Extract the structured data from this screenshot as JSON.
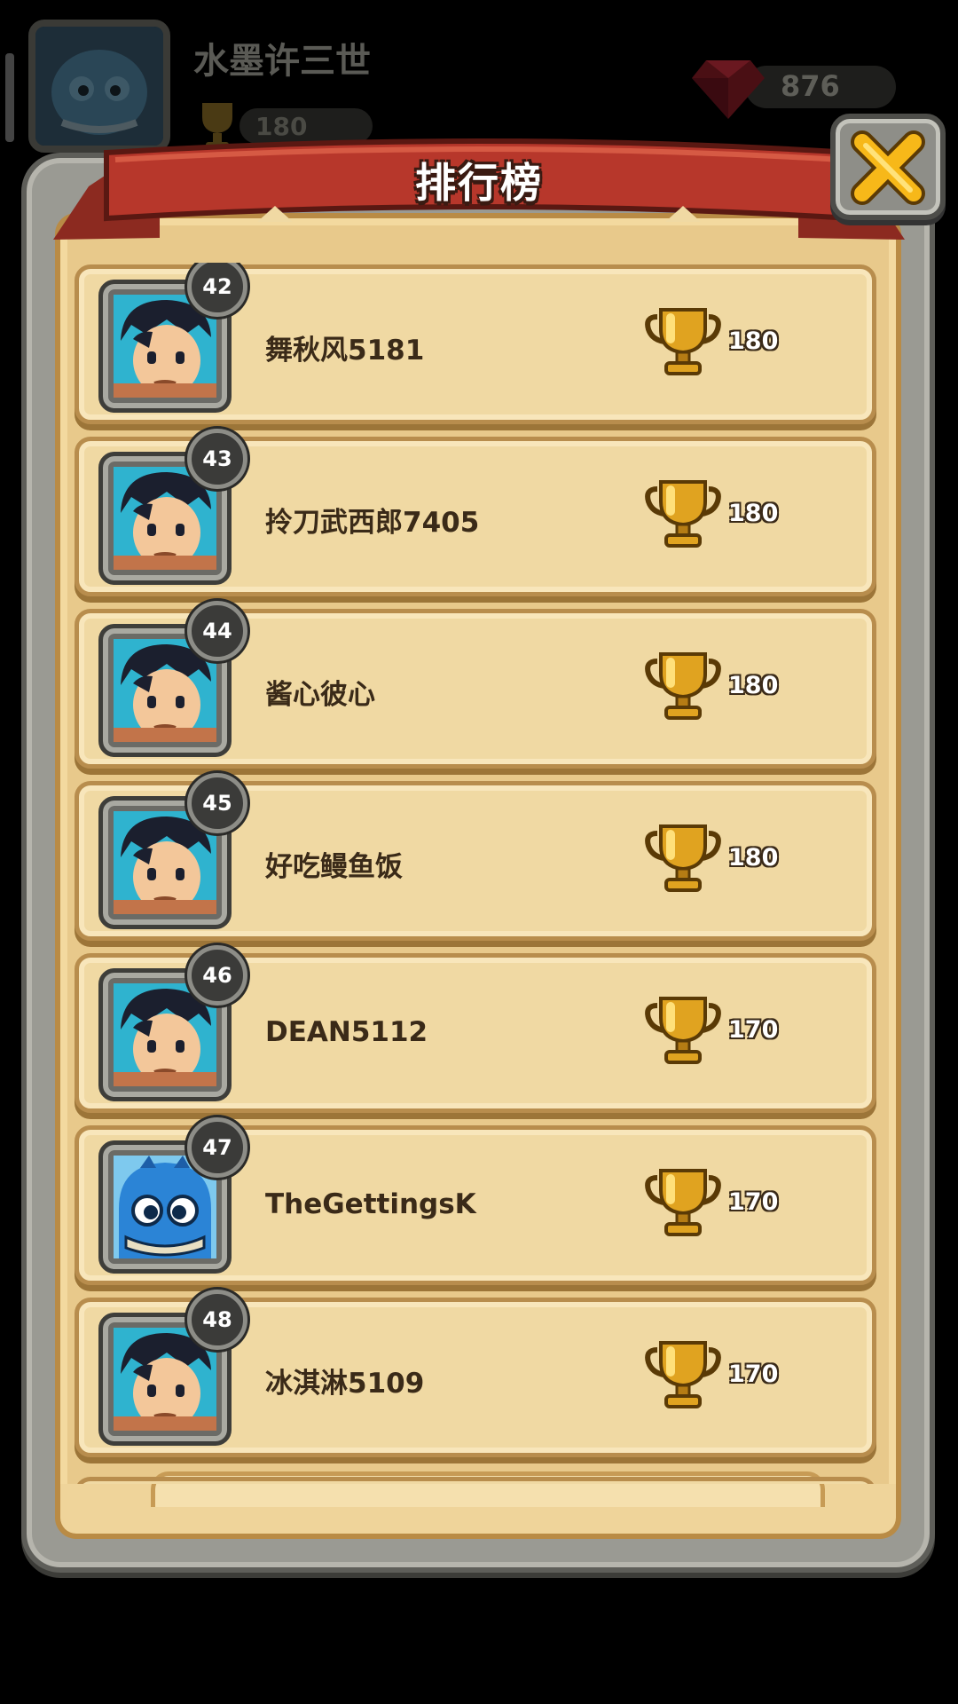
{
  "background": {
    "player_name": "水墨许三世",
    "trophies": "180",
    "gems": "876"
  },
  "dialog": {
    "title": "排行榜",
    "close_icon": "close-x-icon"
  },
  "leaderboard": [
    {
      "rank": "42",
      "name": "舞秋风5181",
      "trophies": "180",
      "avatar": "hero-boy"
    },
    {
      "rank": "43",
      "name": "拎刀武西郎7405",
      "trophies": "180",
      "avatar": "hero-boy"
    },
    {
      "rank": "44",
      "name": "酱心彼心",
      "trophies": "180",
      "avatar": "hero-boy"
    },
    {
      "rank": "45",
      "name": "好吃鳗鱼饭",
      "trophies": "180",
      "avatar": "hero-boy"
    },
    {
      "rank": "46",
      "name": "DEAN5112",
      "trophies": "170",
      "avatar": "hero-boy"
    },
    {
      "rank": "47",
      "name": "TheGettingsK",
      "trophies": "170",
      "avatar": "blue-dragon"
    },
    {
      "rank": "48",
      "name": "冰淇淋5109",
      "trophies": "170",
      "avatar": "hero-boy"
    }
  ],
  "colors": {
    "banner_red": "#b7372b",
    "parchment": "#f0d9a3",
    "trophy_gold": "#e0a320",
    "close_yellow": "#f7b819"
  }
}
